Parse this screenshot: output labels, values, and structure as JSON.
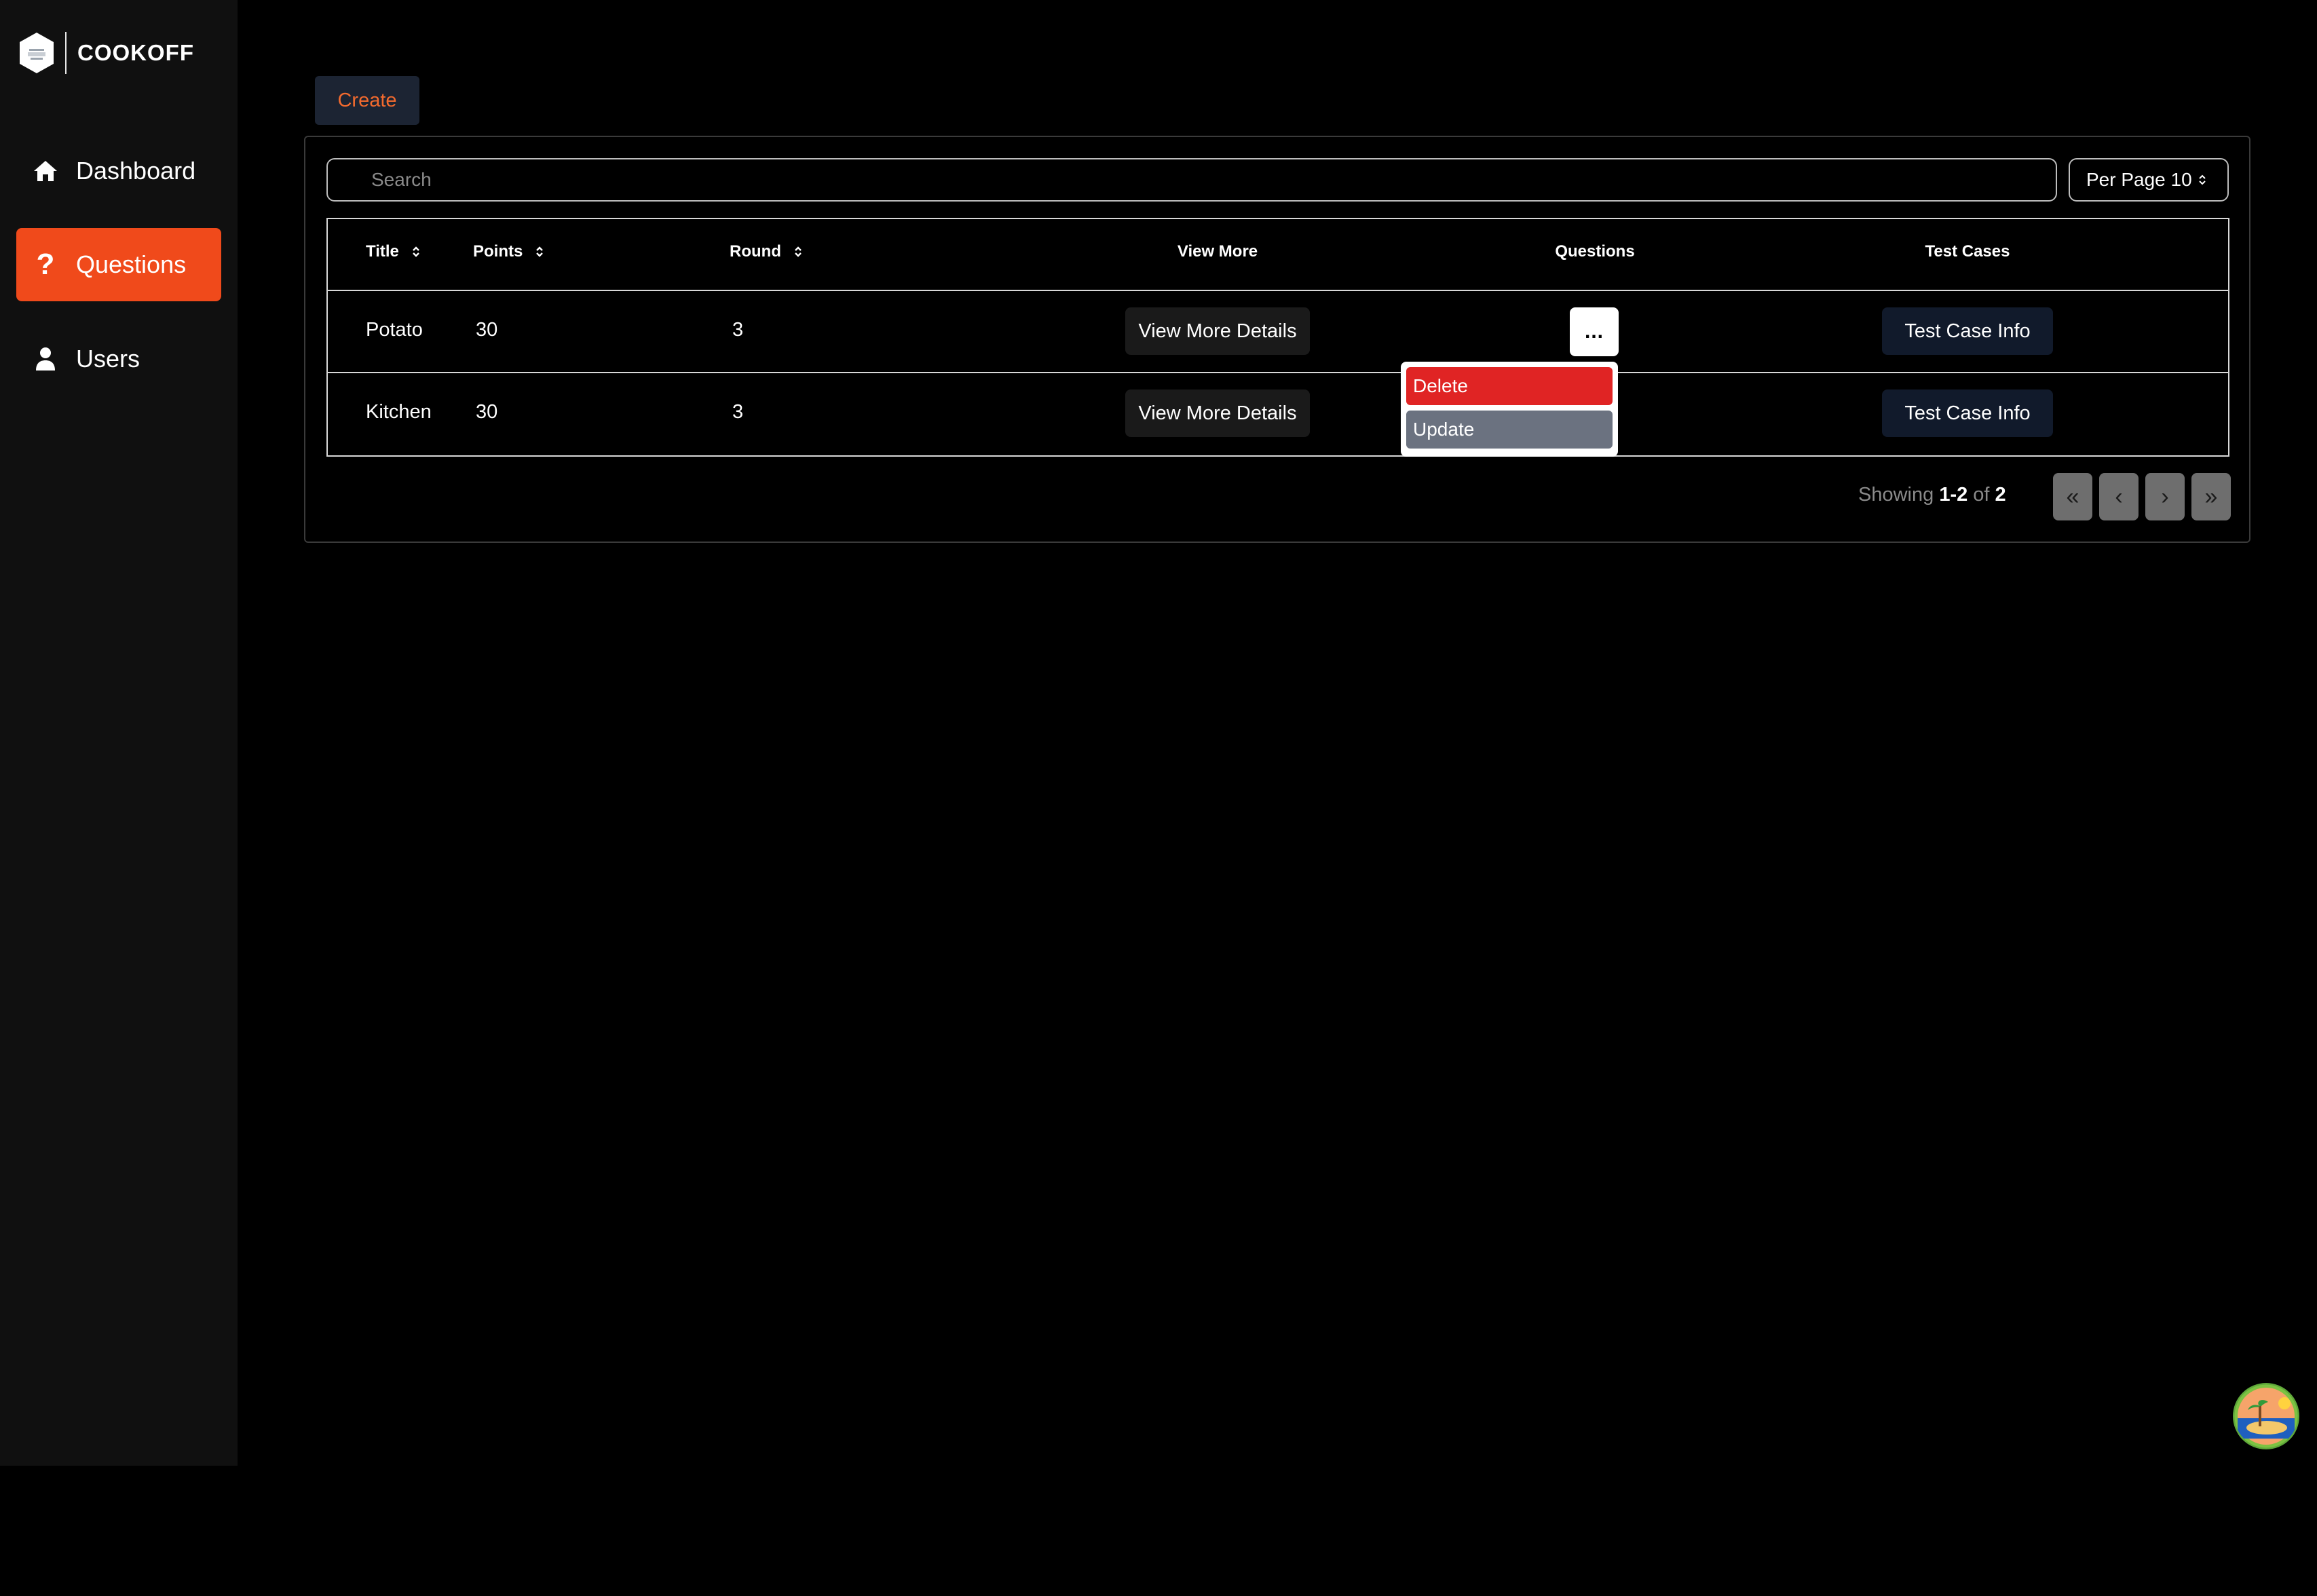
{
  "app": {
    "name": "COOKOFF",
    "accent_color": "#f04a1b"
  },
  "sidebar": {
    "items": [
      {
        "label": "Dashboard",
        "icon": "home-icon",
        "active": false
      },
      {
        "label": "Questions",
        "icon": "question-icon",
        "active": true
      },
      {
        "label": "Users",
        "icon": "user-icon",
        "active": false
      }
    ]
  },
  "toolbar": {
    "create_label": "Create"
  },
  "search": {
    "placeholder": "Search",
    "value": ""
  },
  "per_page": {
    "label": "Per Page 10"
  },
  "table": {
    "columns": [
      "Title",
      "Points",
      "Round",
      "View More",
      "Questions",
      "Test Cases"
    ],
    "rows": [
      {
        "title": "Potato",
        "points": "30",
        "round": "3",
        "view_more": "View More Details",
        "actions": "...",
        "test_cases": "Test Case Info"
      },
      {
        "title": "Kitchen",
        "points": "30",
        "round": "3",
        "view_more": "View More Details",
        "actions": "...",
        "test_cases": "Test Case Info"
      }
    ]
  },
  "actions_menu": {
    "delete_label": "Delete",
    "update_label": "Update"
  },
  "pagination": {
    "showing_prefix": "Showing",
    "range": "1-2",
    "of": "of",
    "total": "2",
    "first": "«",
    "prev": "‹",
    "next": "›",
    "last": "»"
  }
}
